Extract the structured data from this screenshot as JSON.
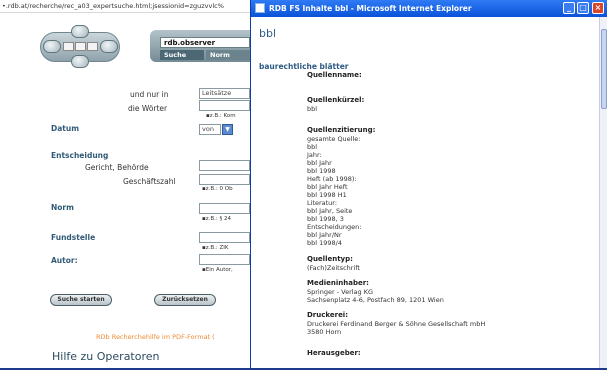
{
  "background": {
    "url": "•.rdb.at/recherche/rec_a03_expertsuche.html;jsessionid=zguzvvlc%",
    "app_name": "rdb.observer",
    "tabs": [
      "Suche",
      "Norm"
    ],
    "form": {
      "und_nur_in": "und nur in",
      "leitsaetze": "Leitsätze",
      "die_woerter": "die Wörter",
      "hint_kom": "z.B.: Kom",
      "datum": "Datum",
      "von": "von",
      "entscheidung": "Entscheidung",
      "gericht": "Gericht, Behörde",
      "geschaeftszahl": "Geschäftszahl",
      "hint_ob": "z.B.: 0 Ob",
      "norm": "Norm",
      "hint_24": "z.B.: § 24",
      "fundstelle": "Fundstelle",
      "hint_zik": "z.B.: ZIK",
      "autor": "Autor:",
      "hint_autor": "Ein Autor,"
    },
    "buttons": {
      "start": "Suche starten",
      "reset": "Zurücksetzen"
    },
    "pdf_link": "RDb Recherchehilfe im PDF-Format (",
    "operators": "Hilfe zu Operatoren"
  },
  "popup": {
    "title": "RDB FS Inhalte bbl - Microsoft Internet Explorer",
    "bbl": "bbl",
    "heading": "baurechtliche blätter",
    "fields": [
      {
        "label": "Quellenname:",
        "value": ""
      },
      {
        "label": "Quellenkürzel:",
        "value": "bbl"
      },
      {
        "label": "Quellenzitierung:",
        "value": "gesamte Quelle:\nbbl\nJahr:\nbbl Jahr\nbbl 1998\nHeft (ab 1998):\nbbl Jahr Heft\nbbl 1998 H1\nLiteratur:\nbbl Jahr, Seite\nbbl 1998, 3\nEntscheidungen:\nbbl Jahr/Nr\nbbl 1998/4"
      },
      {
        "label": "Quellentyp:",
        "value": "(Fach)Zeitschrift"
      },
      {
        "label": "Medieninhaber:",
        "value": "Springer - Verlag KG\nSachsenplatz 4-6, Postfach 89, 1201 Wien"
      },
      {
        "label": "Druckerei:",
        "value": "Druckerei Ferdinand Berger & Söhne Gesellschaft mbH\n3580 Horn"
      },
      {
        "label": "Herausgeber:",
        "value": ""
      }
    ]
  }
}
